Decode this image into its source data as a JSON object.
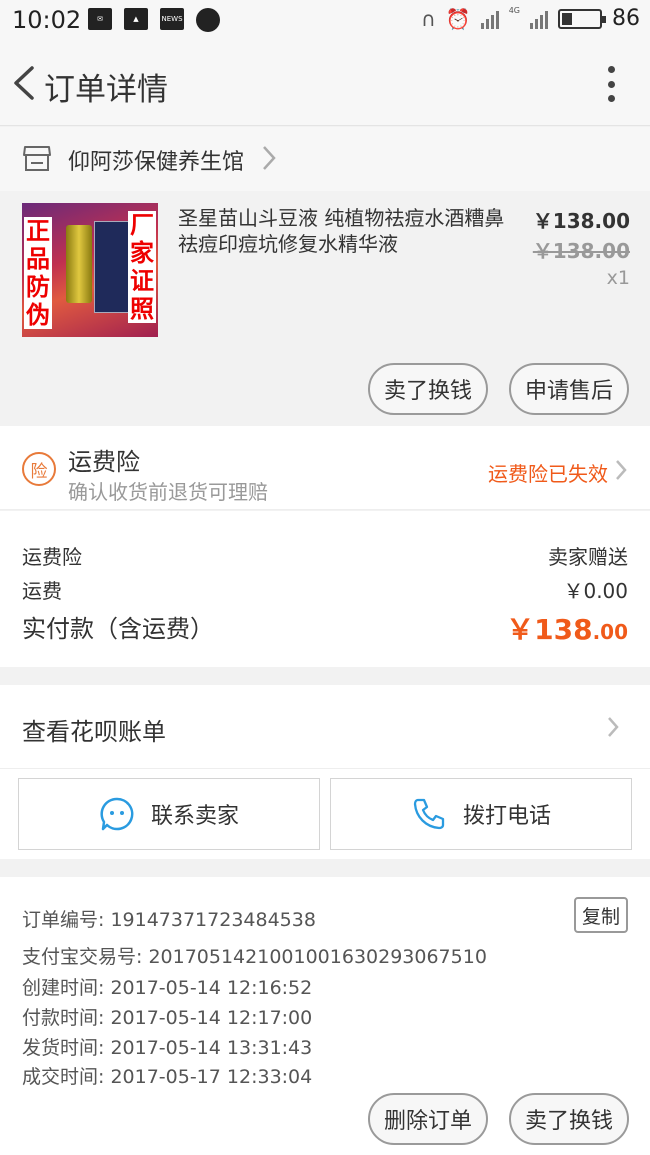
{
  "status_bar": {
    "time": "10:02",
    "news_label": "NEWS",
    "network": "4G",
    "battery": "86"
  },
  "header": {
    "title": "订单详情"
  },
  "shop": {
    "name": "仰阿莎保健养生馆"
  },
  "product": {
    "title": "圣星苗山斗豆液 纯植物祛痘水酒糟鼻祛痘印痘坑修复水精华液",
    "price": "￥138.00",
    "original_price": "￥138.00",
    "quantity": "x1",
    "image_tags": [
      "正品防伪",
      "厂家证照"
    ],
    "actions": [
      "卖了换钱",
      "申请售后"
    ]
  },
  "insurance": {
    "icon_char": "险",
    "title": "运费险",
    "subtitle": "确认收货前退货可理赔",
    "status": "运费险已失效",
    "status_color": "#f05a1a"
  },
  "fees": {
    "rows": [
      {
        "label": "运费险",
        "value": "卖家赠送"
      },
      {
        "label": "运费",
        "value": "￥0.00"
      }
    ],
    "total_label": "实付款（含运费）",
    "total_main": "￥138",
    "total_cents": ".00"
  },
  "huabei": {
    "label": "查看花呗账单"
  },
  "contact": {
    "seller_label": "联系卖家",
    "call_label": "拨打电话",
    "accent": "#2a9be0"
  },
  "order_info": {
    "lines": [
      "订单编号: 19147371723484538",
      "支付宝交易号: 2017051421001001630293067510",
      "创建时间: 2017-05-14 12:16:52",
      "付款时间: 2017-05-14 12:17:00",
      "发货时间: 2017-05-14 13:31:43",
      "成交时间: 2017-05-17 12:33:04"
    ],
    "copy_label": "复制"
  },
  "bottom_bar": {
    "delete_label": "删除订单",
    "sell_label": "卖了换钱"
  }
}
